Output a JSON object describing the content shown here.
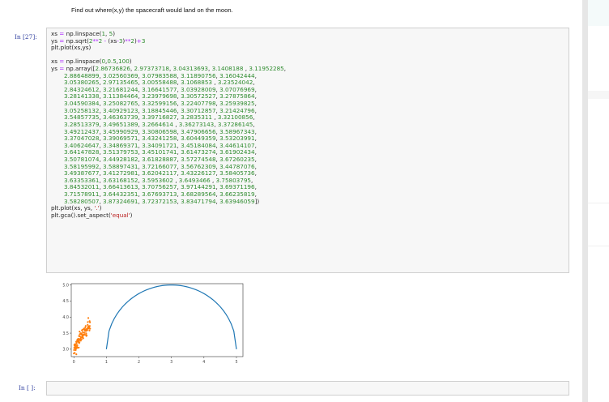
{
  "markdown": {
    "text": "Find out where(x,y) the spacecraft would land on the moon."
  },
  "cell1": {
    "prompt": "In [27]:",
    "lines": [
      "xs = np.linspace(1, 5)",
      "ys = np.sqrt(2**2 - (xs-3)**2)+3",
      "plt.plot(xs,ys)",
      "",
      "xs = np.linspace(0,0.5,100)",
      "ys = np.array([2.86736826, 2.97373718, 3.04313693, 3.1408188 , 3.11952285,",
      "       2.88648899, 3.02560369, 3.07983588, 3.11890756, 3.16042444,",
      "       3.05380265, 2.97135465, 3.00558488, 3.1068853 , 3.23524042,",
      "       2.84324612, 3.21681244, 3.16641577, 3.03928009, 3.07076969,",
      "       3.28141338, 3.11384464, 3.23979698, 3.30572527, 3.27875864,",
      "       3.04590384, 3.25082765, 3.32599156, 3.22407798, 3.25939825,",
      "       3.05258132, 3.40929123, 3.18845446, 3.30712857, 3.21424796,",
      "       3.54857735, 3.46363739, 3.39716827, 3.2835311 , 3.32100856,",
      "       3.28513379, 3.49651389, 3.2664614 , 3.36273143, 3.37286145,",
      "       3.49212437, 3.45990929, 3.30806598, 3.47906656, 3.58967343,",
      "       3.37047028, 3.39069571, 3.43241258, 3.60449359, 3.53203991,",
      "       3.40624647, 3.34869371, 3.34091721, 3.45184084, 3.44614107,",
      "       3.64147828, 3.51379753, 3.45101741, 3.61473274, 3.61902434,",
      "       3.50781074, 3.44928182, 3.61828887, 3.57274548, 3.67260235,",
      "       3.58195992, 3.58897431, 3.72166077, 3.56762309, 3.44787076,",
      "       3.49387677, 3.41272981, 3.62042117, 3.43226127, 3.58405736,",
      "       3.63353361, 3.63168152, 3.5953602 , 3.6493466 , 3.75803795,",
      "       3.84532011, 3.66413613, 3.70756257, 3.97144291, 3.69371196,",
      "       3.71578911, 3.64432351, 3.67693713, 3.68289564, 3.66235819,",
      "       3.58280507, 3.87324691, 3.72372153, 3.83471794, 3.63946059])",
      "plt.plot(xs, ys, '.')",
      "plt.gca().set_aspect('equal')"
    ]
  },
  "cell2": {
    "prompt": "In [ ]:",
    "value": ""
  },
  "chart_data": {
    "type": "line+scatter",
    "xlim": [
      -0.08,
      5.2
    ],
    "ylim": [
      2.77,
      5.04
    ],
    "aspect": "equal",
    "grid": false,
    "x_ticks": [
      "0",
      "1",
      "2",
      "3",
      "4",
      "5"
    ],
    "y_ticks": [
      "3.0",
      "3.5",
      "4.0",
      "4.5",
      "5.0"
    ],
    "series": [
      {
        "kind": "line",
        "color": "#1f77b4",
        "x_linspace": [
          1,
          5,
          50
        ],
        "y_formula": "sqrt(2**2 - (x-3)**2)+3"
      },
      {
        "kind": "scatter",
        "color": "#ff7f0e",
        "x_linspace": [
          0,
          0.5,
          100
        ],
        "y": [
          2.86736826,
          2.97373718,
          3.04313693,
          3.1408188,
          3.11952285,
          2.88648899,
          3.02560369,
          3.07983588,
          3.11890756,
          3.16042444,
          3.05380265,
          2.97135465,
          3.00558488,
          3.1068853,
          3.23524042,
          2.84324612,
          3.21681244,
          3.16641577,
          3.03928009,
          3.07076969,
          3.28141338,
          3.11384464,
          3.23979698,
          3.30572527,
          3.27875864,
          3.04590384,
          3.25082765,
          3.32599156,
          3.22407798,
          3.25939825,
          3.05258132,
          3.40929123,
          3.18845446,
          3.30712857,
          3.21424796,
          3.54857735,
          3.46363739,
          3.39716827,
          3.2835311,
          3.32100856,
          3.28513379,
          3.49651389,
          3.2664614,
          3.36273143,
          3.37286145,
          3.49212437,
          3.45990929,
          3.30806598,
          3.47906656,
          3.58967343,
          3.37047028,
          3.39069571,
          3.43241258,
          3.60449359,
          3.53203991,
          3.40624647,
          3.34869371,
          3.34091721,
          3.45184084,
          3.44614107,
          3.64147828,
          3.51379753,
          3.45101741,
          3.61473274,
          3.61902434,
          3.50781074,
          3.44928182,
          3.61828887,
          3.57274548,
          3.67260235,
          3.58195992,
          3.58897431,
          3.72166077,
          3.56762309,
          3.44787076,
          3.49387677,
          3.41272981,
          3.62042117,
          3.43226127,
          3.58405736,
          3.63353361,
          3.63168152,
          3.5953602,
          3.6493466,
          3.75803795,
          3.84532011,
          3.66413613,
          3.70756257,
          3.97144291,
          3.69371196,
          3.71578911,
          3.64432351,
          3.67693713,
          3.68289564,
          3.66235819,
          3.58280507,
          3.87324691,
          3.72372153,
          3.83471794,
          3.63946059
        ]
      }
    ]
  }
}
